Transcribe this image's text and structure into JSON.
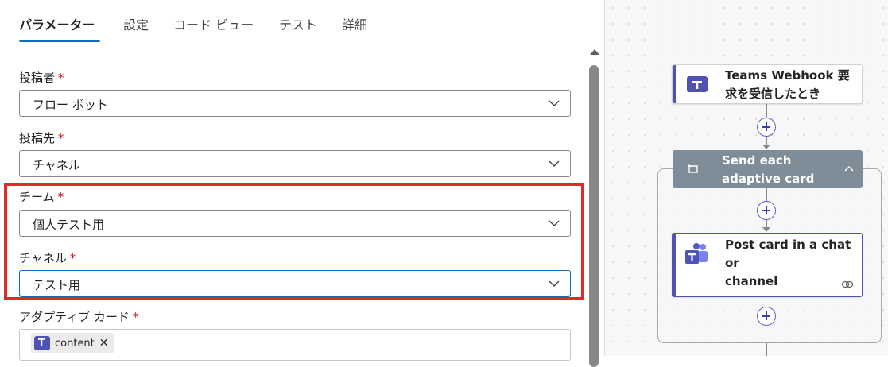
{
  "tabs": [
    {
      "label": "パラメーター",
      "active": true
    },
    {
      "label": "設定"
    },
    {
      "label": "コード ビュー"
    },
    {
      "label": "テスト"
    },
    {
      "label": "詳細"
    }
  ],
  "fields": {
    "poster": {
      "label": "投稿者",
      "required": "*",
      "value": "フロー ボット"
    },
    "post_in": {
      "label": "投稿先",
      "required": "*",
      "value": "チャネル"
    },
    "team": {
      "label": "チーム",
      "required": "*",
      "value": "個人テスト用"
    },
    "channel": {
      "label": "チャネル",
      "required": "*",
      "value": "テスト用"
    },
    "adaptive_card": {
      "label": "アダプティブ カード",
      "required": "*",
      "token": "content",
      "token_remove": "✕"
    }
  },
  "highlight_color": "#e02a2a",
  "flow": {
    "trigger": {
      "title_line1": "Teams Webhook 要",
      "title_line2": "求を受信したとき",
      "icon": "teams-icon"
    },
    "loop": {
      "title_line1": "Send each",
      "title_line2": "adaptive card",
      "icon": "loop-icon",
      "collapse_icon": "chevron-up-icon"
    },
    "action": {
      "title_line1": "Post card in a chat or",
      "title_line2": "channel",
      "icon": "teams-icon",
      "footer_icon": "link-icon"
    }
  },
  "colors": {
    "accent": "#0f6cbd",
    "teams": "#4f52b2",
    "scope_header": "#7f8d99"
  }
}
